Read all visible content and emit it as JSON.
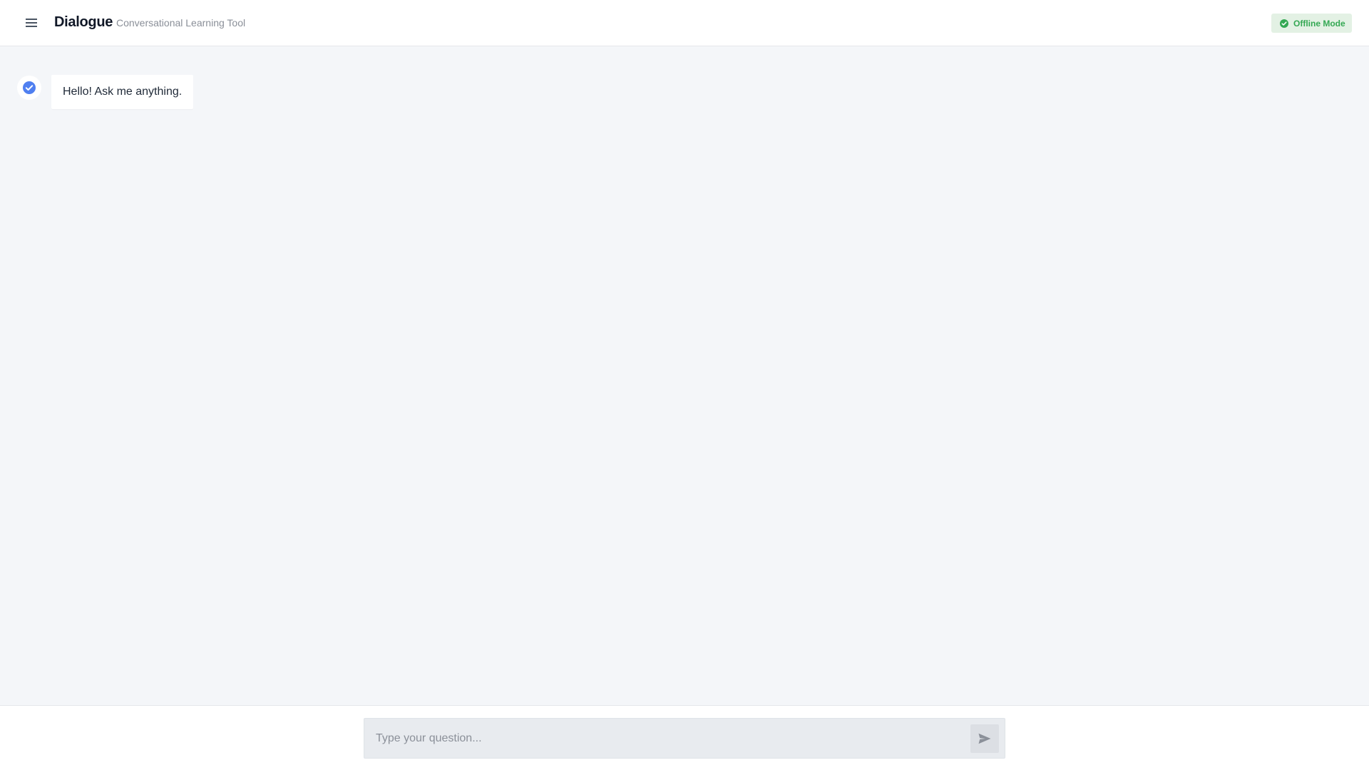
{
  "header": {
    "menu_icon": "hamburger-menu-icon",
    "title": "Dialogue",
    "subtitle": "Conversational Learning Tool",
    "status": {
      "label": "Offline Mode",
      "icon": "check-circle-icon",
      "text_color": "#34a853",
      "bg_color": "#e3f1e4"
    }
  },
  "chat": {
    "messages": [
      {
        "sender": "bot",
        "avatar_icon": "check-circle-icon",
        "avatar_color": "#4f7ff0",
        "text": "Hello! Ask me anything."
      }
    ]
  },
  "composer": {
    "placeholder": "Type your question...",
    "value": "",
    "send_icon": "send-icon"
  }
}
